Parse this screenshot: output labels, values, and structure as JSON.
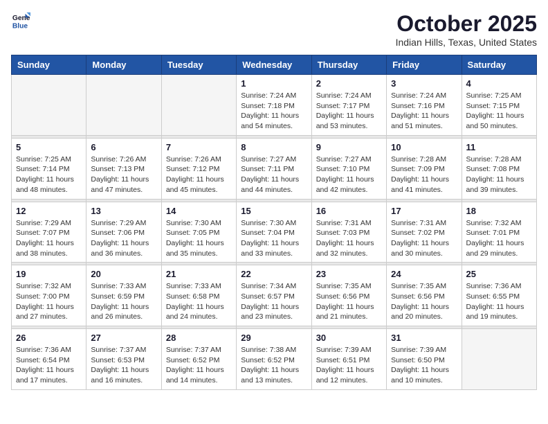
{
  "header": {
    "logo_line1": "General",
    "logo_line2": "Blue",
    "month": "October 2025",
    "location": "Indian Hills, Texas, United States"
  },
  "days_of_week": [
    "Sunday",
    "Monday",
    "Tuesday",
    "Wednesday",
    "Thursday",
    "Friday",
    "Saturday"
  ],
  "weeks": [
    [
      {
        "day": "",
        "info": ""
      },
      {
        "day": "",
        "info": ""
      },
      {
        "day": "",
        "info": ""
      },
      {
        "day": "1",
        "info": "Sunrise: 7:24 AM\nSunset: 7:18 PM\nDaylight: 11 hours\nand 54 minutes."
      },
      {
        "day": "2",
        "info": "Sunrise: 7:24 AM\nSunset: 7:17 PM\nDaylight: 11 hours\nand 53 minutes."
      },
      {
        "day": "3",
        "info": "Sunrise: 7:24 AM\nSunset: 7:16 PM\nDaylight: 11 hours\nand 51 minutes."
      },
      {
        "day": "4",
        "info": "Sunrise: 7:25 AM\nSunset: 7:15 PM\nDaylight: 11 hours\nand 50 minutes."
      }
    ],
    [
      {
        "day": "5",
        "info": "Sunrise: 7:25 AM\nSunset: 7:14 PM\nDaylight: 11 hours\nand 48 minutes."
      },
      {
        "day": "6",
        "info": "Sunrise: 7:26 AM\nSunset: 7:13 PM\nDaylight: 11 hours\nand 47 minutes."
      },
      {
        "day": "7",
        "info": "Sunrise: 7:26 AM\nSunset: 7:12 PM\nDaylight: 11 hours\nand 45 minutes."
      },
      {
        "day": "8",
        "info": "Sunrise: 7:27 AM\nSunset: 7:11 PM\nDaylight: 11 hours\nand 44 minutes."
      },
      {
        "day": "9",
        "info": "Sunrise: 7:27 AM\nSunset: 7:10 PM\nDaylight: 11 hours\nand 42 minutes."
      },
      {
        "day": "10",
        "info": "Sunrise: 7:28 AM\nSunset: 7:09 PM\nDaylight: 11 hours\nand 41 minutes."
      },
      {
        "day": "11",
        "info": "Sunrise: 7:28 AM\nSunset: 7:08 PM\nDaylight: 11 hours\nand 39 minutes."
      }
    ],
    [
      {
        "day": "12",
        "info": "Sunrise: 7:29 AM\nSunset: 7:07 PM\nDaylight: 11 hours\nand 38 minutes."
      },
      {
        "day": "13",
        "info": "Sunrise: 7:29 AM\nSunset: 7:06 PM\nDaylight: 11 hours\nand 36 minutes."
      },
      {
        "day": "14",
        "info": "Sunrise: 7:30 AM\nSunset: 7:05 PM\nDaylight: 11 hours\nand 35 minutes."
      },
      {
        "day": "15",
        "info": "Sunrise: 7:30 AM\nSunset: 7:04 PM\nDaylight: 11 hours\nand 33 minutes."
      },
      {
        "day": "16",
        "info": "Sunrise: 7:31 AM\nSunset: 7:03 PM\nDaylight: 11 hours\nand 32 minutes."
      },
      {
        "day": "17",
        "info": "Sunrise: 7:31 AM\nSunset: 7:02 PM\nDaylight: 11 hours\nand 30 minutes."
      },
      {
        "day": "18",
        "info": "Sunrise: 7:32 AM\nSunset: 7:01 PM\nDaylight: 11 hours\nand 29 minutes."
      }
    ],
    [
      {
        "day": "19",
        "info": "Sunrise: 7:32 AM\nSunset: 7:00 PM\nDaylight: 11 hours\nand 27 minutes."
      },
      {
        "day": "20",
        "info": "Sunrise: 7:33 AM\nSunset: 6:59 PM\nDaylight: 11 hours\nand 26 minutes."
      },
      {
        "day": "21",
        "info": "Sunrise: 7:33 AM\nSunset: 6:58 PM\nDaylight: 11 hours\nand 24 minutes."
      },
      {
        "day": "22",
        "info": "Sunrise: 7:34 AM\nSunset: 6:57 PM\nDaylight: 11 hours\nand 23 minutes."
      },
      {
        "day": "23",
        "info": "Sunrise: 7:35 AM\nSunset: 6:56 PM\nDaylight: 11 hours\nand 21 minutes."
      },
      {
        "day": "24",
        "info": "Sunrise: 7:35 AM\nSunset: 6:56 PM\nDaylight: 11 hours\nand 20 minutes."
      },
      {
        "day": "25",
        "info": "Sunrise: 7:36 AM\nSunset: 6:55 PM\nDaylight: 11 hours\nand 19 minutes."
      }
    ],
    [
      {
        "day": "26",
        "info": "Sunrise: 7:36 AM\nSunset: 6:54 PM\nDaylight: 11 hours\nand 17 minutes."
      },
      {
        "day": "27",
        "info": "Sunrise: 7:37 AM\nSunset: 6:53 PM\nDaylight: 11 hours\nand 16 minutes."
      },
      {
        "day": "28",
        "info": "Sunrise: 7:37 AM\nSunset: 6:52 PM\nDaylight: 11 hours\nand 14 minutes."
      },
      {
        "day": "29",
        "info": "Sunrise: 7:38 AM\nSunset: 6:52 PM\nDaylight: 11 hours\nand 13 minutes."
      },
      {
        "day": "30",
        "info": "Sunrise: 7:39 AM\nSunset: 6:51 PM\nDaylight: 11 hours\nand 12 minutes."
      },
      {
        "day": "31",
        "info": "Sunrise: 7:39 AM\nSunset: 6:50 PM\nDaylight: 11 hours\nand 10 minutes."
      },
      {
        "day": "",
        "info": ""
      }
    ]
  ]
}
